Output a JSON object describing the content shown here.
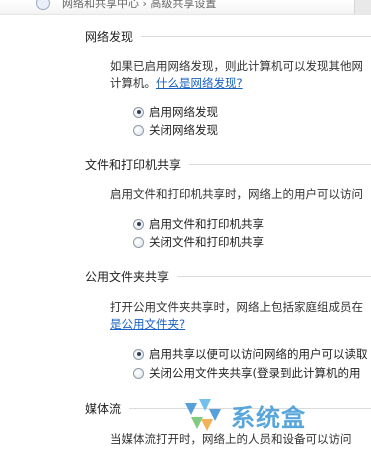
{
  "header": {
    "breadcrumb": "网络和共享中心 › 高级共享设置"
  },
  "network_discovery": {
    "heading": "网络发现",
    "description_line1": "如果已启用网络发现，则此计算机可以发现其他网",
    "description_line2": "计算机。",
    "link": "什么是网络发现?",
    "options": [
      {
        "label": "启用网络发现",
        "checked": true
      },
      {
        "label": "关闭网络发现",
        "checked": false
      }
    ]
  },
  "file_printer_sharing": {
    "heading": "文件和打印机共享",
    "description": "启用文件和打印机共享时，网络上的用户可以访问",
    "options": [
      {
        "label": "启用文件和打印机共享",
        "checked": true
      },
      {
        "label": "关闭文件和打印机共享",
        "checked": false
      }
    ]
  },
  "public_folder_sharing": {
    "heading": "公用文件夹共享",
    "description_line1": "打开公用文件夹共享时，网络上包括家庭组成员在",
    "link": "是公用文件夹?",
    "options": [
      {
        "label": "启用共享以便可以访问网络的用户可以读取",
        "checked": true
      },
      {
        "label": "关闭公用文件夹共享(登录到此计算机的用",
        "checked": false
      }
    ]
  },
  "media_streaming": {
    "heading": "媒体流",
    "description": "当媒体流打开时，网络上的人员和设备可以访问"
  },
  "watermark": {
    "text": "系统盒"
  }
}
